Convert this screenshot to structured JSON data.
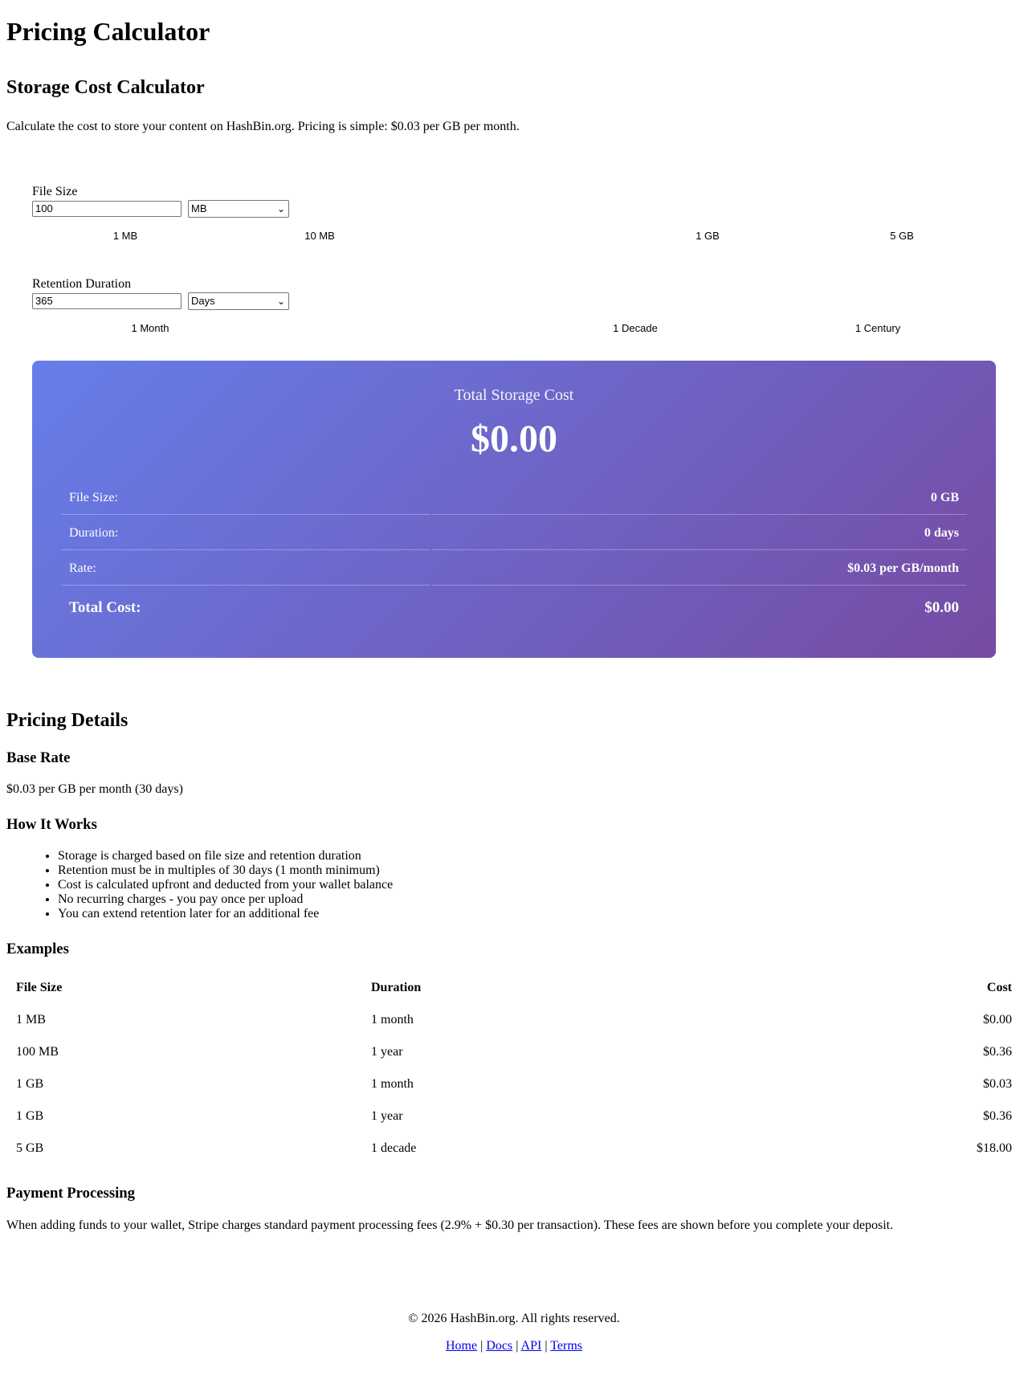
{
  "page": {
    "title": "Pricing Calculator"
  },
  "calculator": {
    "heading": "Storage Cost Calculator",
    "description": "Calculate the cost to store your content on HashBin.org. Pricing is simple: $0.03 per GB per month.",
    "file_size": {
      "label": "File Size",
      "value": "100",
      "unit": "MB",
      "presets": [
        "1 MB",
        "10 MB",
        "1 GB",
        "5 GB"
      ]
    },
    "duration": {
      "label": "Retention Duration",
      "value": "365",
      "unit": "Days",
      "presets": [
        "1 Month",
        "1 Decade",
        "1 Century"
      ]
    },
    "result": {
      "label": "Total Storage Cost",
      "amount": "$0.00",
      "rows": [
        {
          "label": "File Size:",
          "value": "0 GB"
        },
        {
          "label": "Duration:",
          "value": "0 days"
        },
        {
          "label": "Rate:",
          "value": "$0.03 per GB/month"
        }
      ],
      "total_label": "Total Cost:",
      "total_value": "$0.00"
    }
  },
  "details": {
    "heading": "Pricing Details",
    "base_rate": {
      "heading": "Base Rate",
      "text": "$0.03 per GB per month (30 days)"
    },
    "how_it_works": {
      "heading": "How It Works",
      "items": [
        "Storage is charged based on file size and retention duration",
        "Retention must be in multiples of 30 days (1 month minimum)",
        "Cost is calculated upfront and deducted from your wallet balance",
        "No recurring charges - you pay once per upload",
        "You can extend retention later for an additional fee"
      ]
    },
    "examples": {
      "heading": "Examples",
      "columns": [
        "File Size",
        "Duration",
        "Cost"
      ],
      "rows": [
        [
          "1 MB",
          "1 month",
          "$0.00"
        ],
        [
          "100 MB",
          "1 year",
          "$0.36"
        ],
        [
          "1 GB",
          "1 month",
          "$0.03"
        ],
        [
          "1 GB",
          "1 year",
          "$0.36"
        ],
        [
          "5 GB",
          "1 decade",
          "$18.00"
        ]
      ]
    },
    "payment": {
      "heading": "Payment Processing",
      "text": "When adding funds to your wallet, Stripe charges standard payment processing fees (2.9% + $0.30 per transaction). These fees are shown before you complete your deposit."
    }
  },
  "footer": {
    "copyright": "© 2026 HashBin.org. All rights reserved.",
    "links": [
      "Home",
      "Docs",
      "API",
      "Terms"
    ],
    "separator": "|"
  }
}
